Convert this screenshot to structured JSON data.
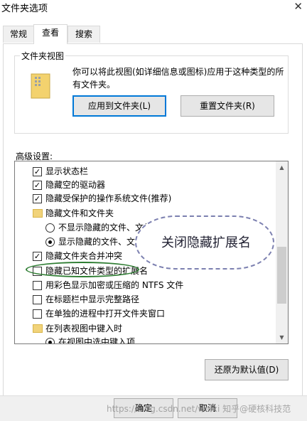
{
  "window": {
    "title": "文件夹选项",
    "close_symbol": "✕"
  },
  "tabs": [
    {
      "label": "常规",
      "active": false
    },
    {
      "label": "查看",
      "active": true
    },
    {
      "label": "搜索",
      "active": false
    }
  ],
  "folder_views": {
    "heading": "文件夹视图",
    "description": "你可以将此视图(如详细信息或图标)应用于这种类型的所有文件夹。",
    "apply_button": "应用到文件夹(L)",
    "reset_button": "重置文件夹(R)"
  },
  "advanced": {
    "heading": "高级设置:",
    "items": [
      {
        "type": "checkbox",
        "checked": true,
        "label": "显示状态栏"
      },
      {
        "type": "checkbox",
        "checked": true,
        "label": "隐藏空的驱动器"
      },
      {
        "type": "checkbox",
        "checked": true,
        "label": "隐藏受保护的操作系统文件(推荐)"
      },
      {
        "type": "folder",
        "label": "隐藏文件和文件夹"
      },
      {
        "type": "radio",
        "checked": false,
        "label": "不显示隐藏的文件、文件夹"
      },
      {
        "type": "radio",
        "checked": true,
        "label": "显示隐藏的文件、文件"
      },
      {
        "type": "checkbox",
        "checked": true,
        "label": "隐藏文件夹合并冲突"
      },
      {
        "type": "checkbox",
        "checked": false,
        "label": "隐藏已知文件类型的扩展名"
      },
      {
        "type": "checkbox",
        "checked": false,
        "label": "用彩色显示加密或压缩的 NTFS 文件"
      },
      {
        "type": "checkbox",
        "checked": false,
        "label": "在标题栏中显示完整路径"
      },
      {
        "type": "checkbox",
        "checked": false,
        "label": "在单独的进程中打开文件夹窗口"
      },
      {
        "type": "folder",
        "label": "在列表视图中键入时"
      },
      {
        "type": "radio",
        "checked": true,
        "label": "在视图中选中键入项"
      }
    ],
    "restore_button": "还原为默认值(D)"
  },
  "annotation": {
    "bubble_text": "关闭隐藏扩展名"
  },
  "footer": {
    "ok_button": "确定",
    "cancel_button": "取消",
    "watermark": "https://blog.csdn.net/weixi 知乎@硬核科技范"
  },
  "colors": {
    "highlight_ellipse": "#2e7d32",
    "bubble_border": "#7c80b0",
    "focus_blue": "#0078d7"
  }
}
